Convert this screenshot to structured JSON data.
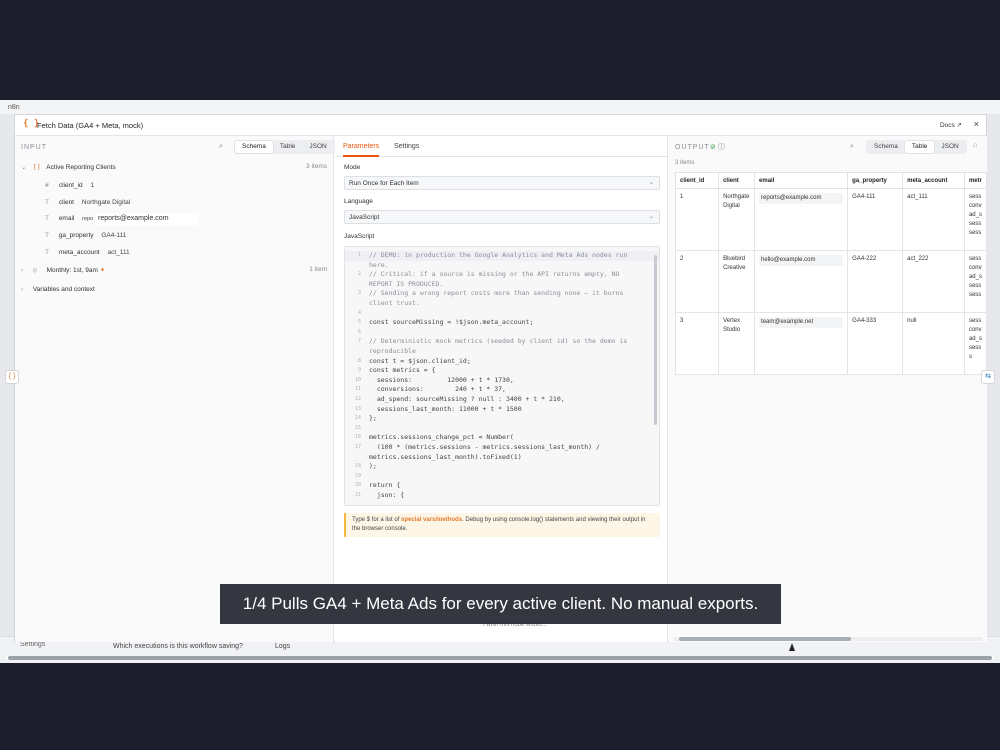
{
  "background": {
    "logo": "n8n",
    "settings_label": "Settings",
    "question": "Which executions is this workflow saving?",
    "logs_label": "Logs"
  },
  "modal": {
    "title": "Fetch Data (GA4 + Meta, mock)",
    "docs_label": "Docs ↗",
    "close": "×"
  },
  "input": {
    "label": "INPUT",
    "tabs": [
      "Schema",
      "Table",
      "JSON"
    ],
    "active_tab": "Schema",
    "root": {
      "name": "Active Reporting Clients",
      "count": "3 items"
    },
    "fields": [
      {
        "type": "#",
        "name": "client_id",
        "value": "1"
      },
      {
        "type": "T",
        "name": "client",
        "value": "Northgate Digital"
      },
      {
        "type": "T",
        "name": "email",
        "value": "reports@example.com",
        "prefix": "repo"
      },
      {
        "type": "T",
        "name": "ga_property",
        "value": "GA4-111"
      },
      {
        "type": "T",
        "name": "meta_account",
        "value": "act_111"
      }
    ],
    "monthly": {
      "name": "Monthly: 1st, 9am",
      "count": "1 item"
    },
    "variables": "Variables and context"
  },
  "params": {
    "tabs": [
      "Parameters",
      "Settings"
    ],
    "mode_label": "Mode",
    "mode_value": "Run Once for Each Item",
    "language_label": "Language",
    "language_value": "JavaScript",
    "code_label": "JavaScript",
    "code_lines": [
      {
        "n": "1",
        "t": "// DEMO: in production the Google Analytics and Meta Ads nodes run",
        "c": "c-com"
      },
      {
        "n": "",
        "t": "here.",
        "c": "c-com"
      },
      {
        "n": "2",
        "t": "// Critical: if a source is missing or the API returns empty, NO",
        "c": "c-com"
      },
      {
        "n": "",
        "t": "REPORT IS PRODUCED.",
        "c": "c-com"
      },
      {
        "n": "3",
        "t": "// Sending a wrong report costs more than sending none — it burns",
        "c": "c-com"
      },
      {
        "n": "",
        "t": "client trust.",
        "c": "c-com"
      },
      {
        "n": "4",
        "t": "",
        "c": "c-plain"
      },
      {
        "n": "5",
        "t": "const sourceMissing = !$json.meta_account;",
        "c": "c-plain"
      },
      {
        "n": "6",
        "t": "",
        "c": "c-plain"
      },
      {
        "n": "7",
        "t": "// Deterministic mock metrics (seeded by client id) so the demo is",
        "c": "c-com"
      },
      {
        "n": "",
        "t": "reproducible",
        "c": "c-com"
      },
      {
        "n": "8",
        "t": "const t = $json.client_id;",
        "c": "c-plain"
      },
      {
        "n": "9",
        "t": "const metrics = {",
        "c": "c-plain"
      },
      {
        "n": "10",
        "t": "  sessions:         12000 + t * 1730,",
        "c": "c-plain"
      },
      {
        "n": "11",
        "t": "  conversions:        240 + t * 37,",
        "c": "c-plain"
      },
      {
        "n": "12",
        "t": "  ad_spend: sourceMissing ? null : 3400 + t * 210,",
        "c": "c-plain"
      },
      {
        "n": "13",
        "t": "  sessions_last_month: 11000 + t * 1500",
        "c": "c-plain"
      },
      {
        "n": "14",
        "t": "};",
        "c": "c-plain"
      },
      {
        "n": "15",
        "t": "",
        "c": "c-plain"
      },
      {
        "n": "16",
        "t": "metrics.sessions_change_pct = Number(",
        "c": "c-plain"
      },
      {
        "n": "17",
        "t": "  (100 * (metrics.sessions - metrics.sessions_last_month) /",
        "c": "c-plain"
      },
      {
        "n": "",
        "t": "metrics.sessions_last_month).toFixed(1)",
        "c": "c-plain"
      },
      {
        "n": "18",
        "t": ");",
        "c": "c-plain"
      },
      {
        "n": "19",
        "t": "",
        "c": "c-plain"
      },
      {
        "n": "20",
        "t": "return {",
        "c": "c-plain"
      },
      {
        "n": "21",
        "t": "  json: {",
        "c": "c-plain"
      }
    ],
    "hint_pre": "Type $ for a list of ",
    "hint_link": "special vars/methods",
    "hint_post": ". Debug by using console.log() statements and viewing their output in the browser console.",
    "wish": "I wish this node would..."
  },
  "output": {
    "label": "OUTPUT",
    "items_count": "3 items",
    "tabs": [
      "Schema",
      "Table",
      "JSON"
    ],
    "active_tab": "Table",
    "columns": [
      "client_id",
      "client",
      "email",
      "ga_property",
      "meta_account",
      "metr"
    ],
    "rows": [
      {
        "client_id": "1",
        "client": "Northgate Digital",
        "email": "reports@example.com",
        "ga_property": "GA4-111",
        "meta_account": "act_111",
        "metrics": "sess conv ad_s sess sess"
      },
      {
        "client_id": "2",
        "client": "Bluebird Creative",
        "email": "hello@example.com",
        "ga_property": "GA4-222",
        "meta_account": "act_222",
        "metrics": "sess conv ad_s sess sess"
      },
      {
        "client_id": "3",
        "client": "Vertex Studio",
        "email": "team@example.net",
        "ga_property": "GA4-333",
        "meta_account": "null",
        "metrics": "sess conv ad_s sess s"
      }
    ]
  },
  "caption": "1/4  Pulls GA4 + Meta Ads for every active client. No manual exports."
}
